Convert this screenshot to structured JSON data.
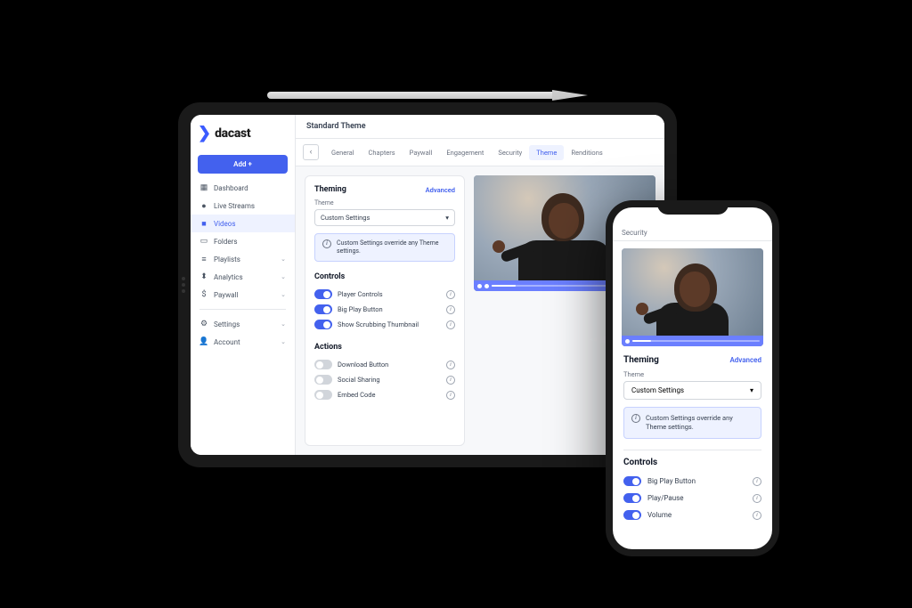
{
  "brand": {
    "name": "dacast"
  },
  "sidebar": {
    "add_label": "Add +",
    "items": [
      {
        "label": "Dashboard",
        "icon": "▦"
      },
      {
        "label": "Live Streams",
        "icon": "●"
      },
      {
        "label": "Videos",
        "icon": "■"
      },
      {
        "label": "Folders",
        "icon": "▭"
      },
      {
        "label": "Playlists",
        "icon": "≡"
      },
      {
        "label": "Analytics",
        "icon": "⬍"
      },
      {
        "label": "Paywall",
        "icon": "$"
      }
    ],
    "bottom": [
      {
        "label": "Settings",
        "icon": "⚙"
      },
      {
        "label": "Account",
        "icon": "👤"
      }
    ]
  },
  "page": {
    "title": "Standard Theme"
  },
  "tabs": [
    "General",
    "Chapters",
    "Paywall",
    "Engagement",
    "Security",
    "Theme",
    "Renditions"
  ],
  "active_tab": "Theme",
  "theming": {
    "heading": "Theming",
    "advanced": "Advanced",
    "field_label": "Theme",
    "selected": "Custom Settings",
    "info": "Custom Settings override any Theme settings."
  },
  "controls": {
    "heading": "Controls",
    "items": [
      {
        "label": "Player Controls",
        "on": true
      },
      {
        "label": "Big Play Button",
        "on": true
      },
      {
        "label": "Show Scrubbing Thumbnail",
        "on": true
      }
    ]
  },
  "actions": {
    "heading": "Actions",
    "items": [
      {
        "label": "Download Button",
        "on": false
      },
      {
        "label": "Social Sharing",
        "on": false
      },
      {
        "label": "Embed Code",
        "on": false
      }
    ]
  },
  "phone": {
    "tab": "Security",
    "theming_heading": "Theming",
    "advanced": "Advanced",
    "field_label": "Theme",
    "selected": "Custom Settings",
    "info": "Custom Settings override any Theme settings.",
    "controls_heading": "Controls",
    "controls": [
      {
        "label": "Big Play Button",
        "on": true
      },
      {
        "label": "Play/Pause",
        "on": true
      },
      {
        "label": "Volume",
        "on": true
      }
    ]
  }
}
